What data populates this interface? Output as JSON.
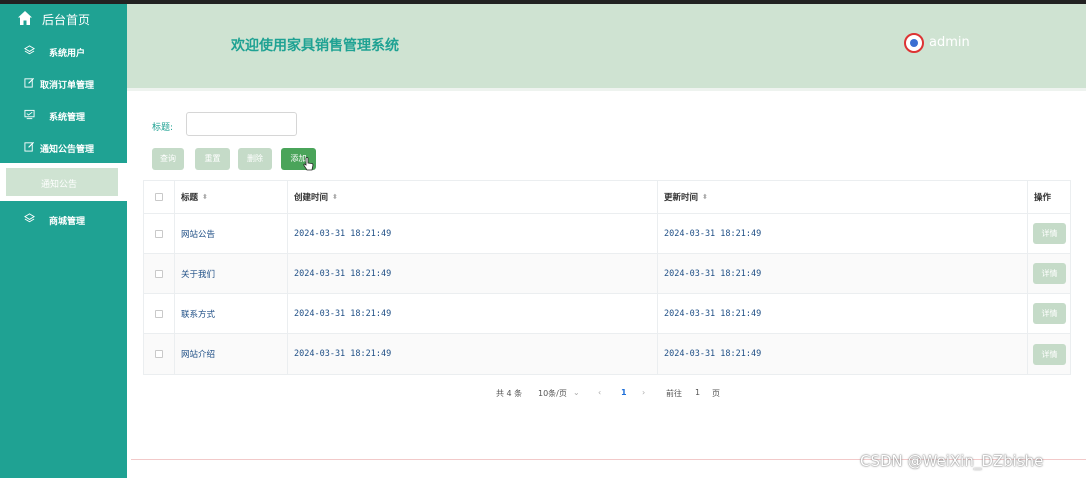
{
  "sidebar": {
    "home_label": "后台首页",
    "items": [
      {
        "label": "系统用户"
      },
      {
        "label": "取消订单管理"
      },
      {
        "label": "系统管理"
      },
      {
        "label": "通知公告管理"
      },
      {
        "label": "商城管理"
      }
    ],
    "active_sub_label": "通知公告",
    "bg_color": "#1fa293"
  },
  "header": {
    "title": "欢迎使用家具销售管理系统",
    "username": "admin"
  },
  "search": {
    "label": "标题:",
    "placeholder": ""
  },
  "toolbar": {
    "query_label": "查询",
    "reset_label": "重置",
    "delete_label": "删除",
    "add_label": "添加"
  },
  "table": {
    "headers": [
      "标题",
      "创建时间",
      "更新时间",
      "操作"
    ],
    "rows": [
      {
        "title": "网站公告",
        "created": "2024-03-31 18:21:49",
        "updated": "2024-03-31 18:21:49",
        "action": "详情"
      },
      {
        "title": "关于我们",
        "created": "2024-03-31 18:21:49",
        "updated": "2024-03-31 18:21:49",
        "action": "详情"
      },
      {
        "title": "联系方式",
        "created": "2024-03-31 18:21:49",
        "updated": "2024-03-31 18:21:49",
        "action": "详情"
      },
      {
        "title": "网站介绍",
        "created": "2024-03-31 18:21:49",
        "updated": "2024-03-31 18:21:49",
        "action": "详情"
      }
    ]
  },
  "pagination": {
    "total": "共 4 条",
    "page_size": "10条/页",
    "current_page": "1",
    "goto_label": "前往",
    "goto_value": "1",
    "page_suffix": "页"
  },
  "watermark": "CSDN @WeiXin_DZbishe"
}
